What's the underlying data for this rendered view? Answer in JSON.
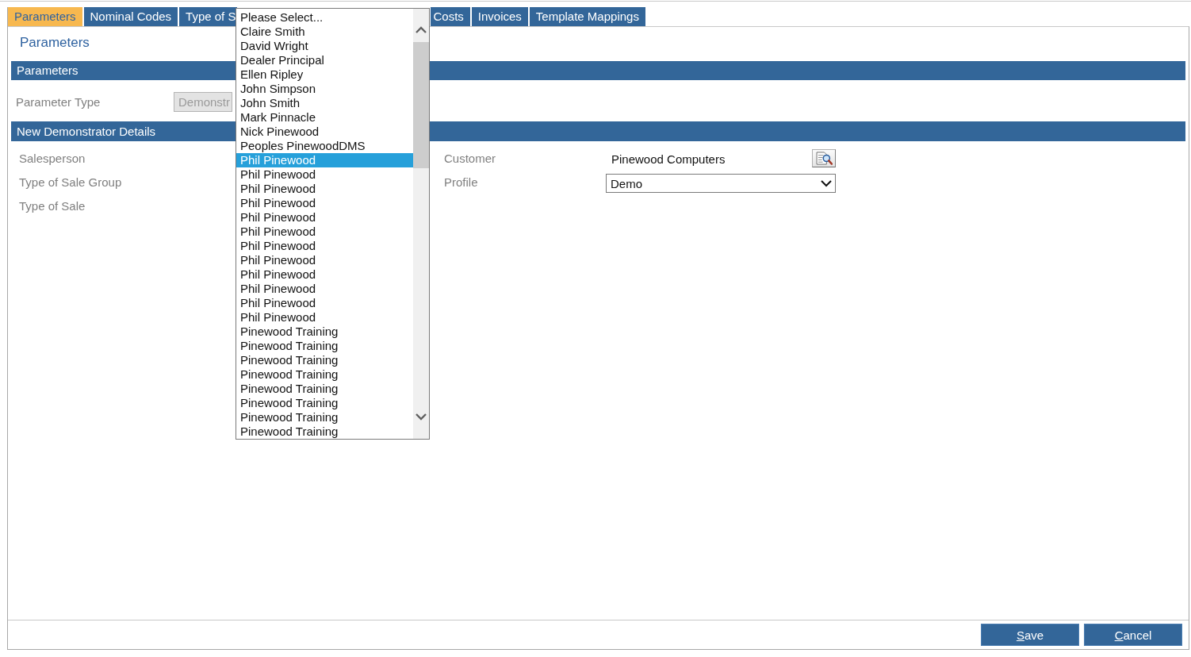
{
  "tabs": [
    {
      "label": "Parameters",
      "selected": true,
      "kind": "whole"
    },
    {
      "label": "Nominal Codes",
      "selected": false,
      "kind": "whole"
    },
    {
      "label": "Type of S",
      "selected": false,
      "kind": "cutright"
    },
    {
      "label": "Costs",
      "selected": false,
      "kind": "cutleft"
    },
    {
      "label": "Invoices",
      "selected": false,
      "kind": "whole"
    },
    {
      "label": "Template Mappings",
      "selected": false,
      "kind": "whole"
    }
  ],
  "page_title": "Parameters",
  "parameters_section": {
    "title": "Parameters",
    "fields": [
      {
        "label": "Parameter Type",
        "value": "Demonstr",
        "disabled": true
      }
    ]
  },
  "details_section": {
    "title": "New Demonstrator Details",
    "left_fields": [
      {
        "label": "Salesperson"
      },
      {
        "label": "Type of Sale Group"
      },
      {
        "label": "Type of Sale"
      }
    ],
    "right_fields": [
      {
        "label": "Customer",
        "kind": "lookup",
        "value": "Pinewood Computers"
      },
      {
        "label": "Profile",
        "kind": "select",
        "value": "Demo"
      }
    ]
  },
  "salesperson_dropdown": {
    "options": [
      {
        "label": "Please Select...",
        "selected": false
      },
      {
        "label": "Claire Smith",
        "selected": false
      },
      {
        "label": "David Wright",
        "selected": false
      },
      {
        "label": "Dealer Principal",
        "selected": false
      },
      {
        "label": "Ellen Ripley",
        "selected": false
      },
      {
        "label": "John Simpson",
        "selected": false
      },
      {
        "label": "John Smith",
        "selected": false
      },
      {
        "label": "Mark Pinnacle",
        "selected": false
      },
      {
        "label": "Nick Pinewood",
        "selected": false
      },
      {
        "label": "Peoples PinewoodDMS",
        "selected": false
      },
      {
        "label": "Phil Pinewood",
        "selected": true
      },
      {
        "label": "Phil Pinewood",
        "selected": false
      },
      {
        "label": "Phil Pinewood",
        "selected": false
      },
      {
        "label": "Phil Pinewood",
        "selected": false
      },
      {
        "label": "Phil Pinewood",
        "selected": false
      },
      {
        "label": "Phil Pinewood",
        "selected": false
      },
      {
        "label": "Phil Pinewood",
        "selected": false
      },
      {
        "label": "Phil Pinewood",
        "selected": false
      },
      {
        "label": "Phil Pinewood",
        "selected": false
      },
      {
        "label": "Phil Pinewood",
        "selected": false
      },
      {
        "label": "Phil Pinewood",
        "selected": false
      },
      {
        "label": "Phil Pinewood",
        "selected": false
      },
      {
        "label": "Pinewood Training",
        "selected": false
      },
      {
        "label": "Pinewood Training",
        "selected": false
      },
      {
        "label": "Pinewood Training",
        "selected": false
      },
      {
        "label": "Pinewood Training",
        "selected": false
      },
      {
        "label": "Pinewood Training",
        "selected": false
      },
      {
        "label": "Pinewood Training",
        "selected": false
      },
      {
        "label": "Pinewood Training",
        "selected": false
      },
      {
        "label": "Pinewood Training",
        "selected": false
      }
    ]
  },
  "buttons": [
    {
      "label": "Save"
    },
    {
      "label": "Cancel"
    }
  ]
}
